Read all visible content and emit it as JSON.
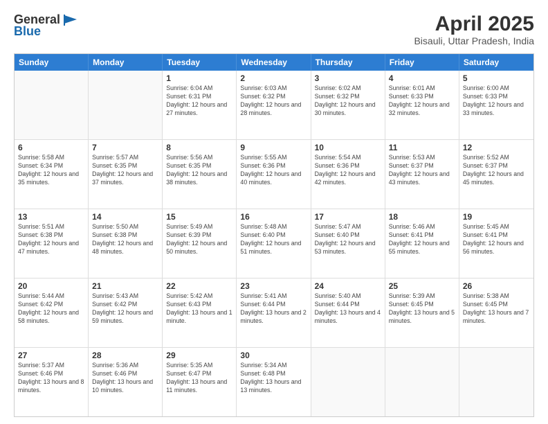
{
  "logo": {
    "general": "General",
    "blue": "Blue"
  },
  "title": "April 2025",
  "subtitle": "Bisauli, Uttar Pradesh, India",
  "header_days": [
    "Sunday",
    "Monday",
    "Tuesday",
    "Wednesday",
    "Thursday",
    "Friday",
    "Saturday"
  ],
  "rows": [
    [
      {
        "day": "",
        "empty": true
      },
      {
        "day": "",
        "empty": true
      },
      {
        "day": "1",
        "detail": "Sunrise: 6:04 AM\nSunset: 6:31 PM\nDaylight: 12 hours and 27 minutes."
      },
      {
        "day": "2",
        "detail": "Sunrise: 6:03 AM\nSunset: 6:32 PM\nDaylight: 12 hours and 28 minutes."
      },
      {
        "day": "3",
        "detail": "Sunrise: 6:02 AM\nSunset: 6:32 PM\nDaylight: 12 hours and 30 minutes."
      },
      {
        "day": "4",
        "detail": "Sunrise: 6:01 AM\nSunset: 6:33 PM\nDaylight: 12 hours and 32 minutes."
      },
      {
        "day": "5",
        "detail": "Sunrise: 6:00 AM\nSunset: 6:33 PM\nDaylight: 12 hours and 33 minutes."
      }
    ],
    [
      {
        "day": "6",
        "detail": "Sunrise: 5:58 AM\nSunset: 6:34 PM\nDaylight: 12 hours and 35 minutes."
      },
      {
        "day": "7",
        "detail": "Sunrise: 5:57 AM\nSunset: 6:35 PM\nDaylight: 12 hours and 37 minutes."
      },
      {
        "day": "8",
        "detail": "Sunrise: 5:56 AM\nSunset: 6:35 PM\nDaylight: 12 hours and 38 minutes."
      },
      {
        "day": "9",
        "detail": "Sunrise: 5:55 AM\nSunset: 6:36 PM\nDaylight: 12 hours and 40 minutes."
      },
      {
        "day": "10",
        "detail": "Sunrise: 5:54 AM\nSunset: 6:36 PM\nDaylight: 12 hours and 42 minutes."
      },
      {
        "day": "11",
        "detail": "Sunrise: 5:53 AM\nSunset: 6:37 PM\nDaylight: 12 hours and 43 minutes."
      },
      {
        "day": "12",
        "detail": "Sunrise: 5:52 AM\nSunset: 6:37 PM\nDaylight: 12 hours and 45 minutes."
      }
    ],
    [
      {
        "day": "13",
        "detail": "Sunrise: 5:51 AM\nSunset: 6:38 PM\nDaylight: 12 hours and 47 minutes."
      },
      {
        "day": "14",
        "detail": "Sunrise: 5:50 AM\nSunset: 6:38 PM\nDaylight: 12 hours and 48 minutes."
      },
      {
        "day": "15",
        "detail": "Sunrise: 5:49 AM\nSunset: 6:39 PM\nDaylight: 12 hours and 50 minutes."
      },
      {
        "day": "16",
        "detail": "Sunrise: 5:48 AM\nSunset: 6:40 PM\nDaylight: 12 hours and 51 minutes."
      },
      {
        "day": "17",
        "detail": "Sunrise: 5:47 AM\nSunset: 6:40 PM\nDaylight: 12 hours and 53 minutes."
      },
      {
        "day": "18",
        "detail": "Sunrise: 5:46 AM\nSunset: 6:41 PM\nDaylight: 12 hours and 55 minutes."
      },
      {
        "day": "19",
        "detail": "Sunrise: 5:45 AM\nSunset: 6:41 PM\nDaylight: 12 hours and 56 minutes."
      }
    ],
    [
      {
        "day": "20",
        "detail": "Sunrise: 5:44 AM\nSunset: 6:42 PM\nDaylight: 12 hours and 58 minutes."
      },
      {
        "day": "21",
        "detail": "Sunrise: 5:43 AM\nSunset: 6:42 PM\nDaylight: 12 hours and 59 minutes."
      },
      {
        "day": "22",
        "detail": "Sunrise: 5:42 AM\nSunset: 6:43 PM\nDaylight: 13 hours and 1 minute."
      },
      {
        "day": "23",
        "detail": "Sunrise: 5:41 AM\nSunset: 6:44 PM\nDaylight: 13 hours and 2 minutes."
      },
      {
        "day": "24",
        "detail": "Sunrise: 5:40 AM\nSunset: 6:44 PM\nDaylight: 13 hours and 4 minutes."
      },
      {
        "day": "25",
        "detail": "Sunrise: 5:39 AM\nSunset: 6:45 PM\nDaylight: 13 hours and 5 minutes."
      },
      {
        "day": "26",
        "detail": "Sunrise: 5:38 AM\nSunset: 6:45 PM\nDaylight: 13 hours and 7 minutes."
      }
    ],
    [
      {
        "day": "27",
        "detail": "Sunrise: 5:37 AM\nSunset: 6:46 PM\nDaylight: 13 hours and 8 minutes."
      },
      {
        "day": "28",
        "detail": "Sunrise: 5:36 AM\nSunset: 6:46 PM\nDaylight: 13 hours and 10 minutes."
      },
      {
        "day": "29",
        "detail": "Sunrise: 5:35 AM\nSunset: 6:47 PM\nDaylight: 13 hours and 11 minutes."
      },
      {
        "day": "30",
        "detail": "Sunrise: 5:34 AM\nSunset: 6:48 PM\nDaylight: 13 hours and 13 minutes."
      },
      {
        "day": "",
        "empty": true
      },
      {
        "day": "",
        "empty": true
      },
      {
        "day": "",
        "empty": true
      }
    ]
  ]
}
